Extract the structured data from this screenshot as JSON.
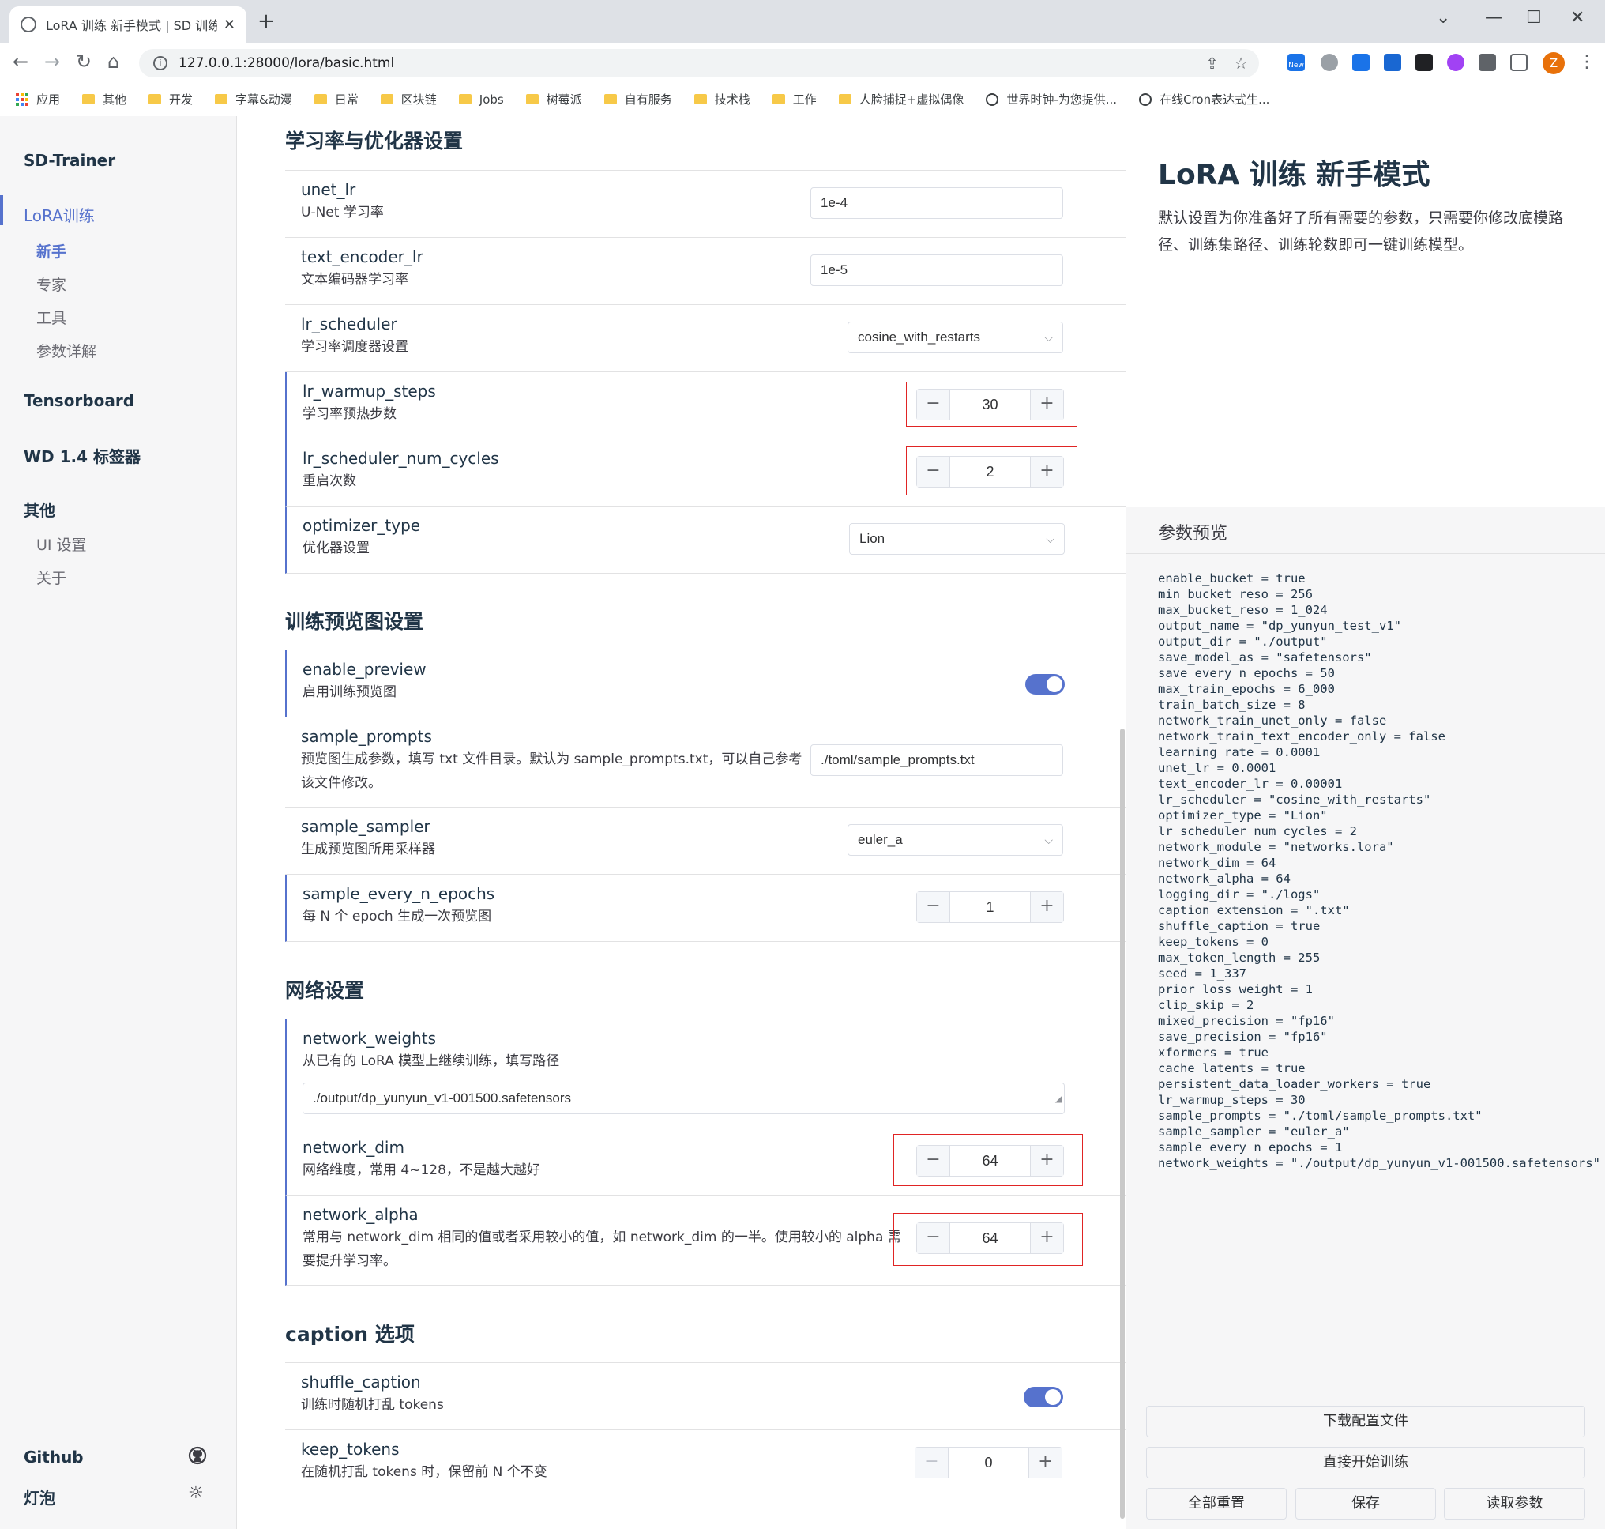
{
  "browser": {
    "tab_title": "LoRA 训练 新手模式 | SD 训练 UI",
    "url": "127.0.0.1:28000/lora/basic.html",
    "bookmarks": [
      "应用",
      "其他",
      "开发",
      "字幕&动漫",
      "日常",
      "区块链",
      "Jobs",
      "树莓派",
      "自有服务",
      "技术栈",
      "工作",
      "人脸捕捉+虚拟偶像",
      "世界时钟-为您提供...",
      "在线Cron表达式生..."
    ],
    "ext_new_badge": "New",
    "avatar_letter": "Z"
  },
  "sidebar": {
    "brand": "SD-Trainer",
    "lora_group": "LoRA训练",
    "lora_items": [
      "新手",
      "专家",
      "工具",
      "参数详解"
    ],
    "tensorboard": "Tensorboard",
    "wd_tagger": "WD 1.4 标签器",
    "other_group": "其他",
    "other_items": [
      "UI 设置",
      "关于"
    ],
    "github": "Github",
    "bulb": "灯泡"
  },
  "sections": {
    "lr": "学习率与优化器设置",
    "preview": "训练预览图设置",
    "network": "网络设置",
    "caption": "caption 选项"
  },
  "params": {
    "unet_lr": {
      "name": "unet_lr",
      "desc": "U-Net 学习率",
      "value": "1e-4"
    },
    "text_encoder_lr": {
      "name": "text_encoder_lr",
      "desc": "文本编码器学习率",
      "value": "1e-5"
    },
    "lr_scheduler": {
      "name": "lr_scheduler",
      "desc": "学习率调度器设置",
      "value": "cosine_with_restarts"
    },
    "lr_warmup_steps": {
      "name": "lr_warmup_steps",
      "desc": "学习率预热步数",
      "value": "30"
    },
    "lr_scheduler_num_cycles": {
      "name": "lr_scheduler_num_cycles",
      "desc": "重启次数",
      "value": "2"
    },
    "optimizer_type": {
      "name": "optimizer_type",
      "desc": "优化器设置",
      "value": "Lion"
    },
    "enable_preview": {
      "name": "enable_preview",
      "desc": "启用训练预览图",
      "value": true
    },
    "sample_prompts": {
      "name": "sample_prompts",
      "desc1": "预览图生成参数，填写 txt 文件目录。默认为 sample_prompts.txt，可以自己参考",
      "desc2": "该文件修改。",
      "value": "./toml/sample_prompts.txt"
    },
    "sample_sampler": {
      "name": "sample_sampler",
      "desc": "生成预览图所用采样器",
      "value": "euler_a"
    },
    "sample_every_n_epochs": {
      "name": "sample_every_n_epochs",
      "desc": "每 N 个 epoch 生成一次预览图",
      "value": "1"
    },
    "network_weights": {
      "name": "network_weights",
      "desc": "从已有的 LoRA 模型上继续训练，填写路径",
      "value": "./output/dp_yunyun_v1-001500.safetensors"
    },
    "network_dim": {
      "name": "network_dim",
      "desc": "网络维度，常用 4~128，不是越大越好",
      "value": "64"
    },
    "network_alpha": {
      "name": "network_alpha",
      "desc1": "常用与 network_dim 相同的值或者采用较小的值，如 network_dim 的一半。使用较小的 alpha 需",
      "desc2": "要提升学习率。",
      "value": "64"
    },
    "shuffle_caption": {
      "name": "shuffle_caption",
      "desc": "训练时随机打乱 tokens",
      "value": true
    },
    "keep_tokens": {
      "name": "keep_tokens",
      "desc": "在随机打乱 tokens 时，保留前 N 个不变",
      "value": "0"
    }
  },
  "stepper_glyphs": {
    "minus": "−",
    "plus": "+"
  },
  "right_panel": {
    "title": "LoRA 训练 新手模式",
    "desc": "默认设置为你准备好了所有需要的参数，只需要你修改底模路径、训练集路径、训练轮数即可一键训练模型。",
    "preview_title": "参数预览",
    "toml": "enable_bucket = true\nmin_bucket_reso = 256\nmax_bucket_reso = 1_024\noutput_name = \"dp_yunyun_test_v1\"\noutput_dir = \"./output\"\nsave_model_as = \"safetensors\"\nsave_every_n_epochs = 50\nmax_train_epochs = 6_000\ntrain_batch_size = 8\nnetwork_train_unet_only = false\nnetwork_train_text_encoder_only = false\nlearning_rate = 0.0001\nunet_lr = 0.0001\ntext_encoder_lr = 0.00001\nlr_scheduler = \"cosine_with_restarts\"\noptimizer_type = \"Lion\"\nlr_scheduler_num_cycles = 2\nnetwork_module = \"networks.lora\"\nnetwork_dim = 64\nnetwork_alpha = 64\nlogging_dir = \"./logs\"\ncaption_extension = \".txt\"\nshuffle_caption = true\nkeep_tokens = 0\nmax_token_length = 255\nseed = 1_337\nprior_loss_weight = 1\nclip_skip = 2\nmixed_precision = \"fp16\"\nsave_precision = \"fp16\"\nxformers = true\ncache_latents = true\npersistent_data_loader_workers = true\nlr_warmup_steps = 30\nsample_prompts = \"./toml/sample_prompts.txt\"\nsample_sampler = \"euler_a\"\nsample_every_n_epochs = 1\nnetwork_weights = \"./output/dp_yunyun_v1-001500.safetensors\"",
    "btn_download": "下载配置文件",
    "btn_start": "直接开始训练",
    "btn_reset": "全部重置",
    "btn_save": "保存",
    "btn_load": "读取参数"
  },
  "colors": {
    "accent": "#5672cd",
    "highlight_box": "#e02424"
  }
}
